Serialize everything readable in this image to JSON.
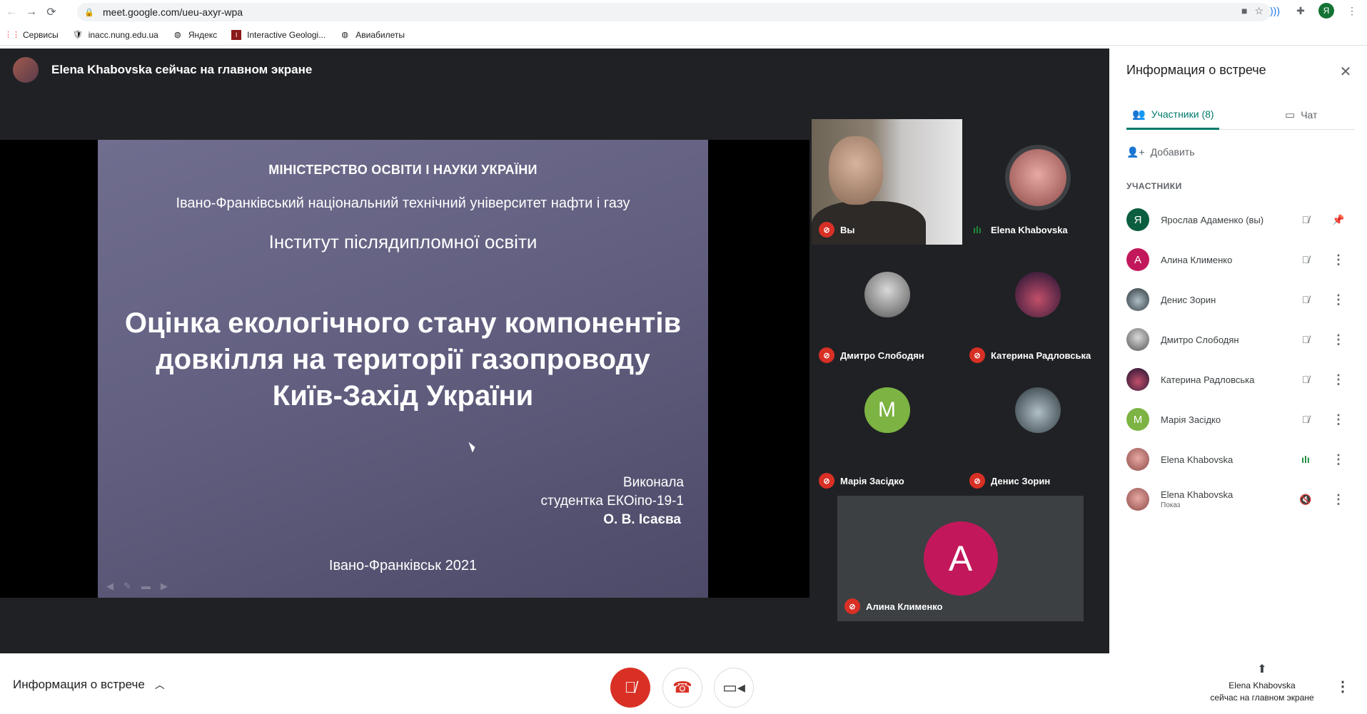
{
  "browser": {
    "url": "meet.google.com/ueu-axyr-wpa",
    "profile_initial": "Я",
    "bookmarks": [
      "Сервисы",
      "inacc.nung.edu.ua",
      "Яндекс",
      "Interactive Geologi...",
      "Авиабилеты"
    ]
  },
  "stage": {
    "presenter_text": "Elena Khabovska сейчас на главном экране"
  },
  "slide": {
    "line1": "МІНІСТЕРСТВО ОСВІТИ І НАУКИ УКРАЇНИ",
    "line2": "Івано-Франківський національний технічний університет нафти і газу",
    "line3": "Інститут післядипломної освіти",
    "title": "Оцінка екологічного стану компонентів довкілля на території газопроводу Київ-Захід України",
    "author_l1": "Виконала",
    "author_l2": "студентка ЕКОіпо-19-1",
    "author_l3": "О. В. Ісаєва",
    "footer": "Івано-Франківськ 2021"
  },
  "tiles": [
    {
      "name": "Вы",
      "muted": true
    },
    {
      "name": "Elena Khabovska",
      "muted": false
    },
    {
      "name": "Дмитро Слободян",
      "muted": true
    },
    {
      "name": "Катерина Радловська",
      "muted": true
    },
    {
      "name": "Марія Засідко",
      "muted": true,
      "initial": "M"
    },
    {
      "name": "Денис Зорин",
      "muted": true
    },
    {
      "name": "Алина Клименко",
      "muted": true,
      "initial": "A"
    }
  ],
  "panel": {
    "title": "Информация о встрече",
    "tab_participants": "Участники (8)",
    "tab_chat": "Чат",
    "add": "Добавить",
    "section": "УЧАСТНИКИ",
    "participants": [
      {
        "name": "Ярослав Адаменко (вы)",
        "initial": "Я",
        "color": "#0b5e3f"
      },
      {
        "name": "Алина Клименко",
        "initial": "А",
        "color": "#c2185b"
      },
      {
        "name": "Денис Зорин",
        "initial": "",
        "color": "#37474f"
      },
      {
        "name": "Дмитро Слободян",
        "initial": "",
        "color": "#5d5d5d"
      },
      {
        "name": "Катерина Радловська",
        "initial": "",
        "color": "#3a2c44"
      },
      {
        "name": "Марія Засідко",
        "initial": "M",
        "color": "#7cb342"
      },
      {
        "name": "Elena Khabovska",
        "initial": "",
        "color": "#8d5a55"
      },
      {
        "name": "Elena Khabovska",
        "sub": "Показ",
        "initial": "",
        "color": "#8d5a55"
      }
    ]
  },
  "bottom": {
    "meet_info": "Информация о встрече",
    "present_l1": "Elena Khabovska",
    "present_l2": "сейчас на главном экране"
  },
  "colors": {
    "accent": "#00796b",
    "mic_off": "#d93025",
    "stage_bg": "#202124"
  }
}
